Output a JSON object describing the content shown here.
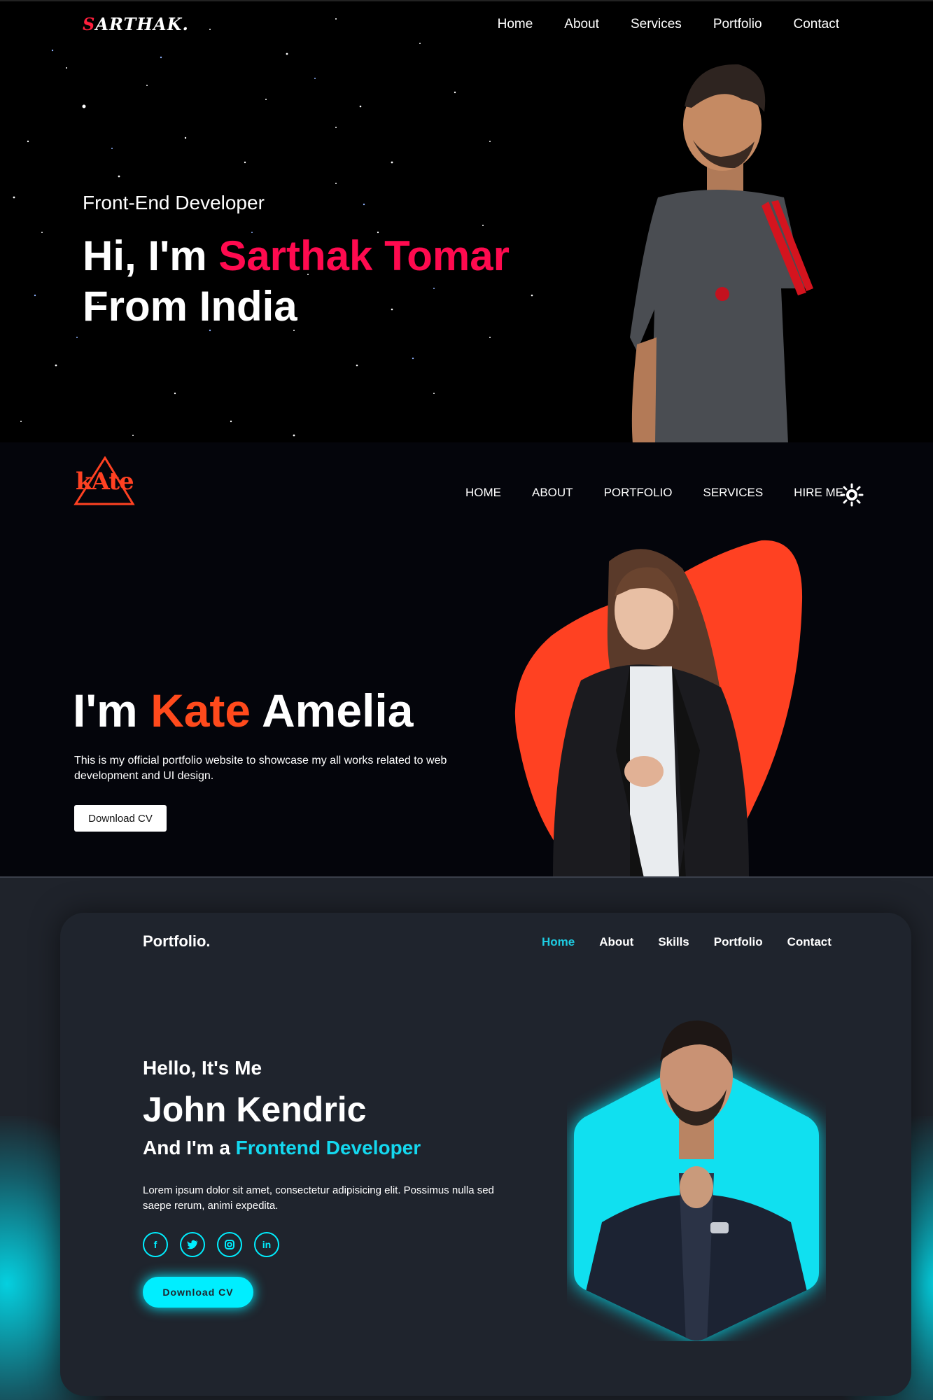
{
  "section1": {
    "logo_first": "S",
    "logo_rest": "ARTHAK.",
    "nav": [
      "Home",
      "About",
      "Services",
      "Portfolio",
      "Contact"
    ],
    "role": "Front-End Developer",
    "greeting": "Hi, I'm ",
    "name": "Sarthak Tomar",
    "line2": "From India",
    "accent_color": "#ff0a4f"
  },
  "section2": {
    "logo_text": "kAte",
    "nav": [
      "HOME",
      "ABOUT",
      "PORTFOLIO",
      "SERVICES",
      "HIRE ME"
    ],
    "theme_toggle_icon": "sun-icon",
    "heading_pre": "I'm ",
    "heading_accent": "Kate",
    "heading_post": " Amelia",
    "description": "This is my official portfolio website to showcase my all works related to web development and UI design.",
    "button_label": "Download CV",
    "accent_color": "#ff4a1c"
  },
  "section3": {
    "logo": "Portfolio.",
    "nav": [
      "Home",
      "About",
      "Skills",
      "Portfolio",
      "Contact"
    ],
    "active_nav": "Home",
    "hello": "Hello, It's Me",
    "name": "John Kendric",
    "role_pre": "And I'm a ",
    "role_accent": "Frontend Developer",
    "description": "Lorem ipsum dolor sit amet, consectetur adipisicing elit. Possimus nulla sed saepe rerum, animi expedita.",
    "socials": [
      "facebook-icon",
      "twitter-icon",
      "instagram-icon",
      "linkedin-icon"
    ],
    "button_label": "Download CV",
    "accent_color": "#00eeff"
  }
}
